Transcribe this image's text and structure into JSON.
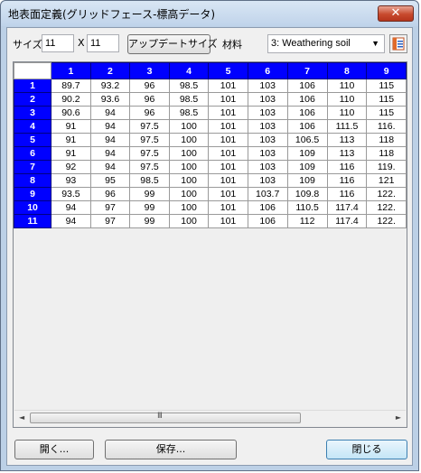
{
  "window": {
    "title": "地表面定義(グリッドフェース-標高データ)",
    "close_symbol": "✕"
  },
  "toolbar": {
    "size_label": "サイズ",
    "size_x_value": "11",
    "times_label": "X",
    "size_y_value": "11",
    "update_size_label": "アップデートサイズ",
    "material_label": "材料",
    "material_value": "3: Weathering soil",
    "material_options_icon": "book-icon"
  },
  "grid": {
    "columns": [
      "1",
      "2",
      "3",
      "4",
      "5",
      "6",
      "7",
      "8",
      "9"
    ],
    "rows": [
      {
        "label": "1",
        "cells": [
          "89.7",
          "93.2",
          "96",
          "98.5",
          "101",
          "103",
          "106",
          "110",
          "115"
        ]
      },
      {
        "label": "2",
        "cells": [
          "90.2",
          "93.6",
          "96",
          "98.5",
          "101",
          "103",
          "106",
          "110",
          "115"
        ]
      },
      {
        "label": "3",
        "cells": [
          "90.6",
          "94",
          "96",
          "98.5",
          "101",
          "103",
          "106",
          "110",
          "115"
        ]
      },
      {
        "label": "4",
        "cells": [
          "91",
          "94",
          "97.5",
          "100",
          "101",
          "103",
          "106",
          "111.5",
          "116."
        ]
      },
      {
        "label": "5",
        "cells": [
          "91",
          "94",
          "97.5",
          "100",
          "101",
          "103",
          "106.5",
          "113",
          "118"
        ]
      },
      {
        "label": "6",
        "cells": [
          "91",
          "94",
          "97.5",
          "100",
          "101",
          "103",
          "109",
          "113",
          "118"
        ]
      },
      {
        "label": "7",
        "cells": [
          "92",
          "94",
          "97.5",
          "100",
          "101",
          "103",
          "109",
          "116",
          "119."
        ]
      },
      {
        "label": "8",
        "cells": [
          "93",
          "95",
          "98.5",
          "100",
          "101",
          "103",
          "109",
          "116",
          "121"
        ]
      },
      {
        "label": "9",
        "cells": [
          "93.5",
          "96",
          "99",
          "100",
          "101",
          "103.7",
          "109.8",
          "116",
          "122."
        ]
      },
      {
        "label": "10",
        "cells": [
          "94",
          "97",
          "99",
          "100",
          "101",
          "106",
          "110.5",
          "117.4",
          "122."
        ]
      },
      {
        "label": "11",
        "cells": [
          "94",
          "97",
          "99",
          "100",
          "101",
          "106",
          "112",
          "117.4",
          "122."
        ]
      }
    ],
    "scroll_left": "◄",
    "scroll_right": "►",
    "scroll_grip": "III"
  },
  "footer": {
    "open_label": "開く...",
    "save_label": "保存...",
    "close_label": "閉じる"
  }
}
